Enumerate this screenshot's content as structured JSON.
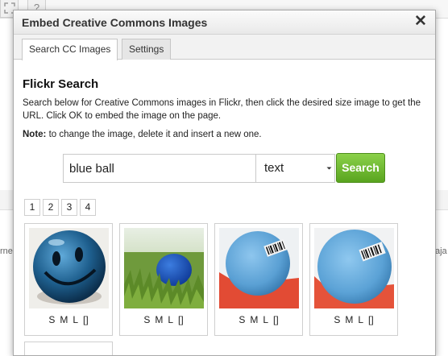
{
  "background": {
    "toolbar_icons": [
      "fullscreen-icon",
      "help-icon"
    ],
    "help_glyph": "?",
    "left_text": "rne",
    "right_text": "aja"
  },
  "dialog": {
    "title": "Embed Creative Commons Images",
    "close_glyph": "✕",
    "tabs": [
      {
        "label": "Search CC Images",
        "active": true
      },
      {
        "label": "Settings",
        "active": false
      }
    ],
    "section_title": "Flickr Search",
    "description": "Search below for Creative Commons images in Flickr, then click the desired size image to get the URL. Click OK to embed the image on the page.",
    "note_label": "Note:",
    "note_text": " to change the image, delete it and insert a new one.",
    "search": {
      "value": "blue ball",
      "type_selected": "text",
      "button_label": "Search"
    },
    "pages": [
      "1",
      "2",
      "3",
      "4"
    ],
    "results": [
      {
        "image": "blue smiley face ball on white",
        "sizes": [
          "S",
          "M",
          "L",
          "[]"
        ]
      },
      {
        "image": "blue ball on grass",
        "sizes": [
          "S",
          "M",
          "L",
          "[]"
        ]
      },
      {
        "image": "light blue ball with barcode on red",
        "sizes": [
          "S",
          "M",
          "L",
          "[]"
        ]
      },
      {
        "image": "light blue ball with barcode on red close-up",
        "sizes": [
          "S",
          "M",
          "L",
          "[]"
        ]
      }
    ]
  },
  "colors": {
    "search_button": "#6db52f",
    "dialog_border": "#a9a9a9"
  }
}
